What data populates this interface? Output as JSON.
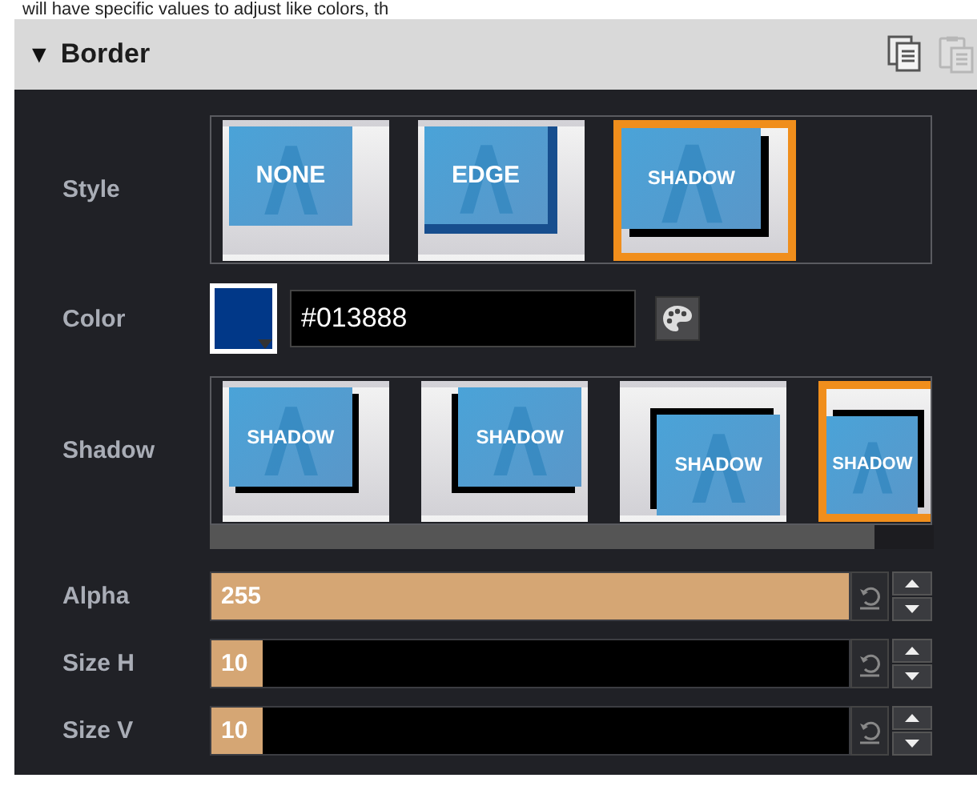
{
  "intro_text": "will have specific values to adjust like colors, th",
  "panel": {
    "toggle": "▼",
    "title": "Border",
    "expanded": true,
    "actions": [
      {
        "kind": "copy",
        "disabled": false
      },
      {
        "kind": "paste",
        "disabled": true
      }
    ]
  },
  "style": {
    "label": "Style",
    "options": [
      {
        "label": "NONE",
        "kind": "none",
        "selected": false
      },
      {
        "label": "EDGE",
        "kind": "edge",
        "selected": false
      },
      {
        "label": "SHADOW",
        "kind": "shadow",
        "selected": true
      }
    ]
  },
  "color": {
    "label": "Color",
    "value": "#013888"
  },
  "shadow": {
    "label": "Shadow",
    "options": [
      {
        "label": "SHADOW",
        "kind": "bottom-right",
        "selected": false
      },
      {
        "label": "SHADOW",
        "kind": "bottom-left",
        "selected": false
      },
      {
        "label": "SHADOW",
        "kind": "top-left",
        "selected": false
      },
      {
        "label": "SHADOW",
        "kind": "top-right",
        "selected": true
      }
    ]
  },
  "sliders": [
    {
      "label": "Alpha",
      "value": "255",
      "level": 1
    },
    {
      "label": "Size H",
      "value": "10",
      "level": 0.08
    },
    {
      "label": "Size V",
      "value": "10",
      "level": 0.08
    }
  ]
}
